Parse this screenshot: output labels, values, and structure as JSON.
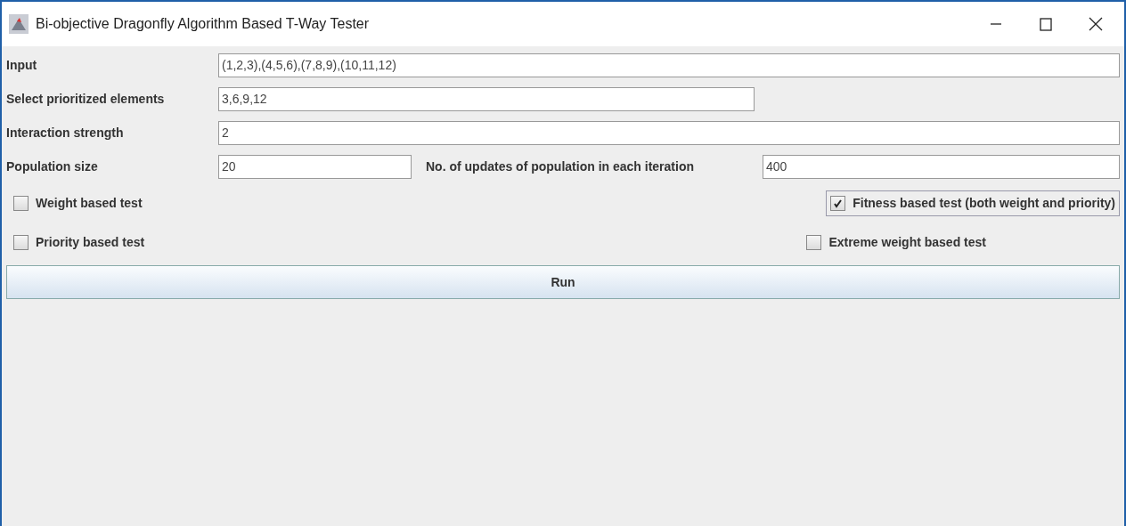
{
  "window": {
    "title": "Bi-objective Dragonfly Algorithm Based T-Way Tester"
  },
  "fields": [
    {
      "label": "Input",
      "value": "(1,2,3),(4,5,6),(7,8,9),(10,11,12)",
      "kind": "full"
    },
    {
      "label": "Select prioritized elements",
      "value": "3,6,9,12",
      "kind": "medium"
    },
    {
      "label": "Interaction strength",
      "value": "2",
      "kind": "full"
    }
  ],
  "population": {
    "label": "Population size",
    "value": "20",
    "updates_label": "No. of updates of population in each iteration",
    "updates_value": "400"
  },
  "option_rows": [
    [
      {
        "label": "Weight based test",
        "checked": false,
        "focused": false
      },
      {
        "label": "Fitness based test (both weight and priority)",
        "checked": true,
        "focused": true
      }
    ],
    [
      {
        "label": "Priority based test",
        "checked": false,
        "focused": false
      },
      {
        "label": "Extreme weight based test",
        "checked": false,
        "focused": false
      }
    ]
  ],
  "run_button": "Run"
}
